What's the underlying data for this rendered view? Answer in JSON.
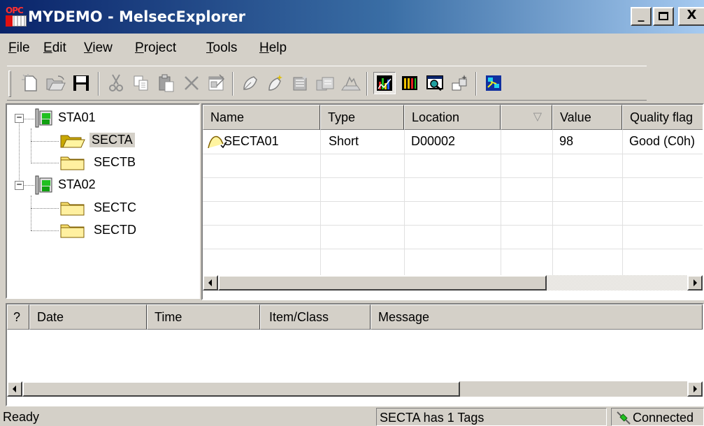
{
  "window": {
    "title": "MYDEMO - MelsecExplorer",
    "icon": "opc-server-icon",
    "icon_text": "OPC",
    "buttons": [
      "minimize",
      "maximize",
      "close"
    ]
  },
  "menu": [
    {
      "label": "File",
      "accel": "F",
      "rest": "ile"
    },
    {
      "label": "Edit",
      "accel": "E",
      "rest": "dit"
    },
    {
      "label": "View",
      "accel": "V",
      "rest": "iew"
    },
    {
      "label": "Project",
      "accel": "P",
      "rest": "roject"
    },
    {
      "label": "Tools",
      "accel": "T",
      "rest": "ools"
    },
    {
      "label": "Help",
      "accel": "H",
      "rest": "elp"
    }
  ],
  "toolbar": {
    "buttons": [
      "new-icon",
      "open-icon",
      "save-icon",
      "cut-icon",
      "copy-icon",
      "paste-icon",
      "delete-icon",
      "properties-icon",
      "new-station-icon",
      "new-section-icon",
      "new-tag-icon",
      "new-multiple-tags-icon",
      "import-icon",
      "monitor-icon",
      "bar-chart-icon",
      "zoom-view-icon",
      "config-icon",
      "network-icon"
    ],
    "active": "monitor-icon"
  },
  "tree": {
    "nodes": [
      {
        "label": "STA01",
        "type": "station",
        "expanded": true,
        "expander": "−",
        "children": [
          {
            "label": "SECTA",
            "type": "section",
            "selected": true,
            "open": true
          },
          {
            "label": "SECTB",
            "type": "section"
          }
        ]
      },
      {
        "label": "STA02",
        "type": "station",
        "expanded": true,
        "expander": "−",
        "children": [
          {
            "label": "SECTC",
            "type": "section"
          },
          {
            "label": "SECTD",
            "type": "section"
          }
        ]
      }
    ]
  },
  "tag_table": {
    "columns": [
      "Name",
      "Type",
      "Location",
      "",
      "Value",
      "Quality flag"
    ],
    "sort_indicator": "▽",
    "rows": [
      {
        "name": "SECTA01",
        "type": "Short",
        "location": "D00002",
        "extra": "",
        "value": "98",
        "quality": "Good (C0h)",
        "icon": "analog-tag-icon"
      }
    ]
  },
  "log_table": {
    "columns": [
      "?",
      "Date",
      "Time",
      "Item/Class",
      "Message"
    ],
    "rows": []
  },
  "statusbar": {
    "left": "Ready",
    "middle": "SECTA has 1 Tags",
    "right": "Connected",
    "right_icon": "connected-plug-icon"
  }
}
